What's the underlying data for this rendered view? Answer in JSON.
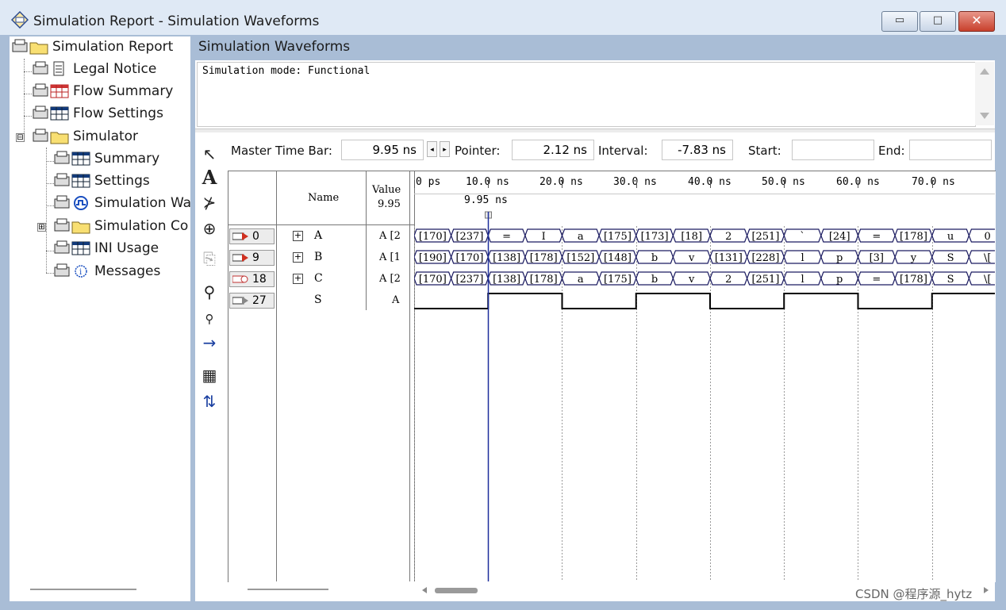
{
  "window": {
    "title": "Simulation Report - Simulation Waveforms",
    "minimize_icon": "minimize-icon",
    "maximize_icon": "maximize-icon",
    "close_icon": "close-icon",
    "min_glyph": "▭",
    "max_glyph": "□",
    "close_glyph": "✕"
  },
  "tree": {
    "items": [
      {
        "label": "Simulation Report",
        "icon": "folder-icon"
      },
      {
        "label": "Legal Notice",
        "icon": "document-icon"
      },
      {
        "label": "Flow Summary",
        "icon": "table-icon"
      },
      {
        "label": "Flow Settings",
        "icon": "table-icon"
      },
      {
        "label": "Simulator",
        "icon": "folder-icon"
      },
      {
        "label": "Summary",
        "icon": "table-icon"
      },
      {
        "label": "Settings",
        "icon": "table-icon"
      },
      {
        "label": "Simulation Wa",
        "icon": "waveform-icon"
      },
      {
        "label": "Simulation Co",
        "icon": "folder-icon"
      },
      {
        "label": "INI Usage",
        "icon": "table-icon"
      },
      {
        "label": "Messages",
        "icon": "info-icon"
      }
    ],
    "expanders": {
      "simulator": "⊟",
      "coverage": "⊞"
    }
  },
  "panel": {
    "title": "Simulation Waveforms",
    "mode_text": "Simulation mode: Functional"
  },
  "timebar": {
    "master_label": "Master Time Bar:",
    "master_value": "9.95 ns",
    "pointer_label": "Pointer:",
    "pointer_value": "2.12 ns",
    "interval_label": "Interval:",
    "interval_value": "-7.83 ns",
    "start_label": "Start:",
    "start_value": "",
    "end_label": "End:",
    "end_value": "",
    "prev_glyph": "◂",
    "next_glyph": "▸"
  },
  "tools": [
    {
      "name": "pointer-tool-icon",
      "glyph": "↖"
    },
    {
      "name": "text-tool-icon",
      "glyph": "A"
    },
    {
      "name": "waveform-edit-icon",
      "glyph": "⊁"
    },
    {
      "name": "zoom-tool-icon",
      "glyph": "⊕"
    },
    {
      "name": "copy-icon",
      "glyph": "⎘"
    },
    {
      "name": "find-icon",
      "glyph": "⚲"
    },
    {
      "name": "find-next-icon",
      "glyph": "⚲"
    },
    {
      "name": "goto-icon",
      "glyph": "→"
    },
    {
      "name": "snap-grid-icon",
      "glyph": "▦"
    },
    {
      "name": "sort-icon",
      "glyph": "⇅"
    }
  ],
  "table": {
    "header_name": "Name",
    "header_value": "Value",
    "header_value_time": "9.95",
    "rows": [
      {
        "id": "0",
        "name": "A",
        "value": "A [2",
        "expandable": true
      },
      {
        "id": "9",
        "name": "B",
        "value": "A [1",
        "expandable": true
      },
      {
        "id": "18",
        "name": "C",
        "value": "A [2",
        "expandable": true
      },
      {
        "id": "27",
        "name": "S",
        "value": "A",
        "expandable": false
      }
    ],
    "expand_glyph": "+"
  },
  "timescale": {
    "ticks": [
      "0 ps",
      "10.0 ns",
      "20.0 ns",
      "30.0 ns",
      "40.0 ns",
      "50.0 ns",
      "60.0 ns",
      "70.0 ns"
    ],
    "master_marker_label": "9.95 ns",
    "master_marker_time_ns": 9.95,
    "ns_per_tick": 10,
    "visible_end_ns": 78.5
  },
  "waves": [
    {
      "signal": "A",
      "values": [
        "[170]",
        "[237]",
        "=",
        "I",
        "a",
        "[175]",
        "[173]",
        "[18]",
        "2",
        "[251]",
        "`",
        "[24]",
        "=",
        "[178]",
        "u",
        "0"
      ]
    },
    {
      "signal": "B",
      "values": [
        "[190]",
        "[170]",
        "[138]",
        "[178]",
        "[152]",
        "[148]",
        "b",
        "v",
        "[131]",
        "[228]",
        "l",
        "p",
        "[3]",
        "y",
        "S",
        "\\["
      ]
    },
    {
      "signal": "C",
      "values": [
        "[170]",
        "[237]",
        "[138]",
        "[178]",
        "a",
        "[175]",
        "b",
        "v",
        "2",
        "[251]",
        "l",
        "p",
        "=",
        "[178]",
        "S",
        "\\["
      ]
    }
  ],
  "bit_wave": {
    "signal": "S",
    "levels": [
      0,
      0,
      1,
      1,
      0,
      0,
      1,
      1,
      0,
      0,
      1,
      1,
      0,
      0,
      1,
      1
    ]
  },
  "watermark": "CSDN @程序源_hytz",
  "colors": {
    "frame": "#a9bdd6",
    "marker": "#1d2f9c",
    "grid": "#9a9a9a"
  }
}
